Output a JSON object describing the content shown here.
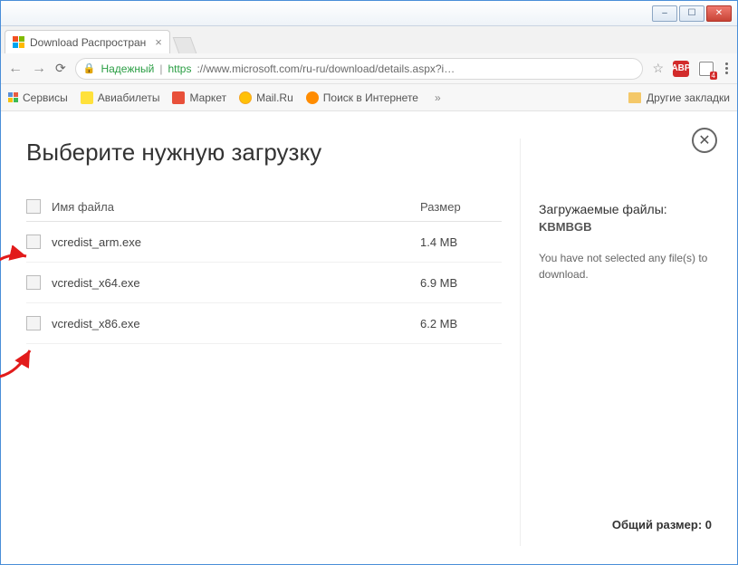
{
  "window": {
    "minimize": "–",
    "maximize": "☐",
    "close": "✕"
  },
  "tab": {
    "title": "Download Распростран",
    "close": "×"
  },
  "addressbar": {
    "secure_label": "Надежный",
    "url_protocol": "https",
    "url_display": "://www.microsoft.com/ru-ru/download/details.aspx?i…",
    "star": "☆",
    "abp": "ABP",
    "lp_badge": "4"
  },
  "bookmarks": {
    "apps": "Сервисы",
    "items": [
      {
        "label": "Авиабилеты"
      },
      {
        "label": "Маркет"
      },
      {
        "label": "Mail.Ru"
      },
      {
        "label": "Поиск в Интернете"
      }
    ],
    "more": "»",
    "other": "Другие закладки"
  },
  "page": {
    "title": "Выберите нужную загрузку",
    "col_name": "Имя файла",
    "col_size": "Размер",
    "files": [
      {
        "name": "vcredist_arm.exe",
        "size": "1.4 MB"
      },
      {
        "name": "vcredist_x64.exe",
        "size": "6.9 MB"
      },
      {
        "name": "vcredist_x86.exe",
        "size": "6.2 MB"
      }
    ],
    "side_heading": "Загружаемые файлы:",
    "side_unit": "KBMBGB",
    "side_text": "You have not selected any file(s) to download.",
    "total_label": "Общий размер: 0",
    "close": "✕"
  }
}
